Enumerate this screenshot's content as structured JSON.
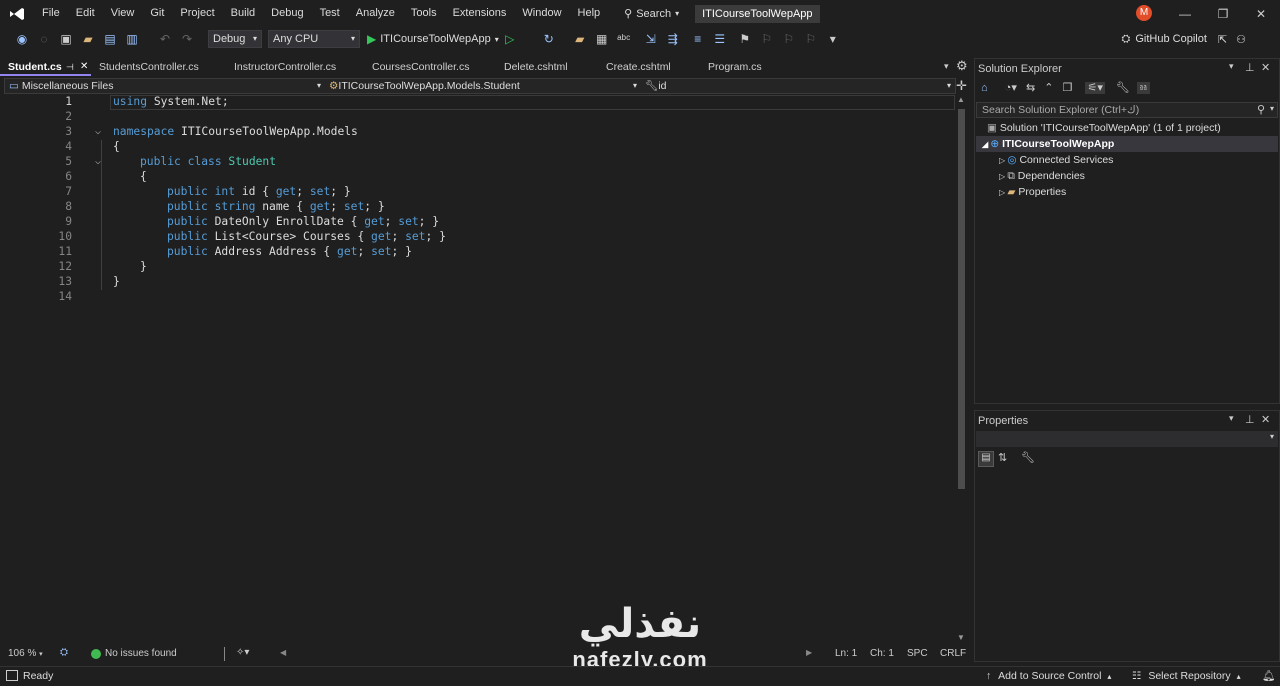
{
  "menu": [
    "File",
    "Edit",
    "View",
    "Git",
    "Project",
    "Build",
    "Debug",
    "Test",
    "Analyze",
    "Tools",
    "Extensions",
    "Window",
    "Help"
  ],
  "search_label": "Search",
  "project_title": "ITICourseToolWepApp",
  "avatar_letter": "M",
  "toolbar": {
    "config": "Debug",
    "platform": "Any CPU",
    "run_target": "ITICourseToolWepApp",
    "copilot": "GitHub Copilot"
  },
  "tabs": [
    "Student.cs",
    "StudentsController.cs",
    "InstructorController.cs",
    "CoursesController.cs",
    "Delete.cshtml",
    "Create.cshtml",
    "Program.cs"
  ],
  "nav": {
    "project": "Miscellaneous Files",
    "type": "ITICourseToolWepApp.Models.Student",
    "member": "id"
  },
  "code_lines": [
    "1",
    "2",
    "3",
    "4",
    "5",
    "6",
    "7",
    "8",
    "9",
    "10",
    "11",
    "12",
    "13",
    "14"
  ],
  "code": {
    "l1_kw": "using",
    "l1_rest": " System.Net;",
    "l3_kw": "namespace",
    "l3_rest": " ITICourseToolWepApp.Models",
    "brace_open": "{",
    "brace_close": "}",
    "l5_kw": "public class",
    "l5_ty": " Student",
    "p1_kw": "public int",
    "p1_rest": " id { ",
    "get": "get",
    "set": "set",
    "sep": "; ",
    "end": "; }",
    "p2_kw": "public string",
    "p2_rest": " name { ",
    "p3_kw": "public",
    "p3_rest": " DateOnly EnrollDate { ",
    "p4_kw": "public",
    "p4_rest": " List<Course> Courses { ",
    "p5_kw": "public",
    "p5_rest": " Address Address { "
  },
  "editor_status": {
    "zoom": "106 %",
    "issues": "No issues found",
    "line": "Ln: 1",
    "ch": "Ch: 1",
    "spc": "SPC",
    "crlf": "CRLF"
  },
  "solution_explorer": {
    "title": "Solution Explorer",
    "search_placeholder": "Search Solution Explorer (Ctrl+ك)",
    "solution": "Solution 'ITICourseToolWepApp' (1 of 1 project)",
    "project": "ITICourseToolWepApp",
    "items": [
      "Connected Services",
      "Dependencies",
      "Properties"
    ]
  },
  "properties_panel": {
    "title": "Properties"
  },
  "statusbar": {
    "ready": "Ready",
    "source_control": "Add to Source Control",
    "repo": "Select Repository"
  },
  "watermark": {
    "arabic": "نفذلي",
    "latin": "nafezly.com"
  }
}
